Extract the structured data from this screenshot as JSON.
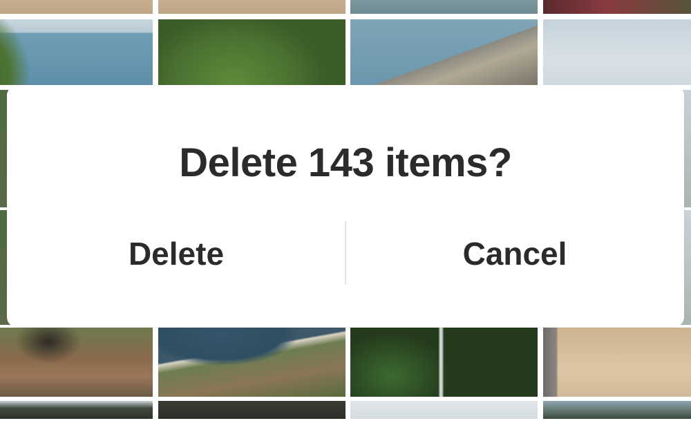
{
  "dialog": {
    "title": "Delete 143 items?",
    "delete_label": "Delete",
    "cancel_label": "Cancel"
  },
  "colors": {
    "dialog_background": "#ffffff",
    "text": "#2b2b2b",
    "divider": "#e6e6e6"
  }
}
